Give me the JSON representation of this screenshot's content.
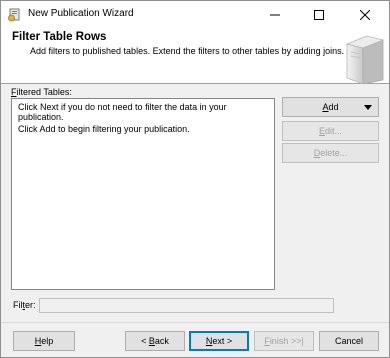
{
  "window": {
    "title": "New Publication Wizard"
  },
  "header": {
    "title": "Filter Table Rows",
    "description": "Add filters to published tables. Extend the filters to other tables by adding joins."
  },
  "filtered_tables": {
    "label_prefix": "F",
    "label_rest": "iltered Tables:",
    "lines": [
      "Click Next if you do not need to filter the data in your publication.",
      "Click Add to begin filtering your publication."
    ]
  },
  "side_buttons": {
    "add": {
      "u": "A",
      "rest": "dd"
    },
    "edit": {
      "u": "E",
      "rest": "dit..."
    },
    "delete": {
      "u": "D",
      "rest": "elete..."
    }
  },
  "filter": {
    "label_prefix": "Fil",
    "label_u": "t",
    "label_rest": "er:",
    "value": ""
  },
  "footer": {
    "help": {
      "u": "H",
      "rest": "elp"
    },
    "back": {
      "pre": "< ",
      "u": "B",
      "rest": "ack"
    },
    "next": {
      "u": "N",
      "rest": "ext >"
    },
    "finish": {
      "u": "F",
      "rest": "inish >>|"
    },
    "cancel": "Cancel"
  }
}
